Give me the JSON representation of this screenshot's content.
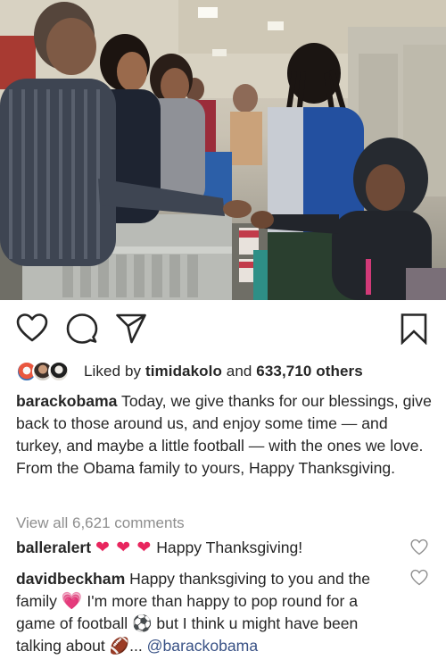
{
  "post": {
    "actions": {
      "like_icon": "heart-outline-icon",
      "comment_icon": "comment-bubble-icon",
      "share_icon": "paper-plane-icon",
      "save_icon": "bookmark-icon"
    },
    "likes": {
      "prefix": "Liked by",
      "user": "timidakolo",
      "joiner": "and",
      "count": "633,710 others"
    },
    "caption": {
      "username": "barackobama",
      "text": "Today, we give thanks for our blessings, give back to those around us, and enjoy some time — and turkey, and maybe a little football — with the ones we love. From the Obama family to yours, Happy Thanksgiving."
    },
    "view_all": "View all 6,621 comments",
    "comments": [
      {
        "username": "balleralert",
        "emoji": "❤ ❤ ❤",
        "text": "Happy Thanksgiving!"
      },
      {
        "username": "davidbeckham",
        "text_a": "Happy thanksgiving to you and the family",
        "emoji_heart": "💗",
        "text_b": "I'm more than happy to pop round for a game of football",
        "emoji_ball": "⚽",
        "text_c": "but I think u might have been talking about",
        "emoji_football": "🏈",
        "ellipsis": "...",
        "mention": "@barackobama"
      }
    ],
    "colors": {
      "text": "#262626",
      "muted": "#8e8e8e",
      "link": "#385185",
      "heart": "#e8265e"
    }
  }
}
